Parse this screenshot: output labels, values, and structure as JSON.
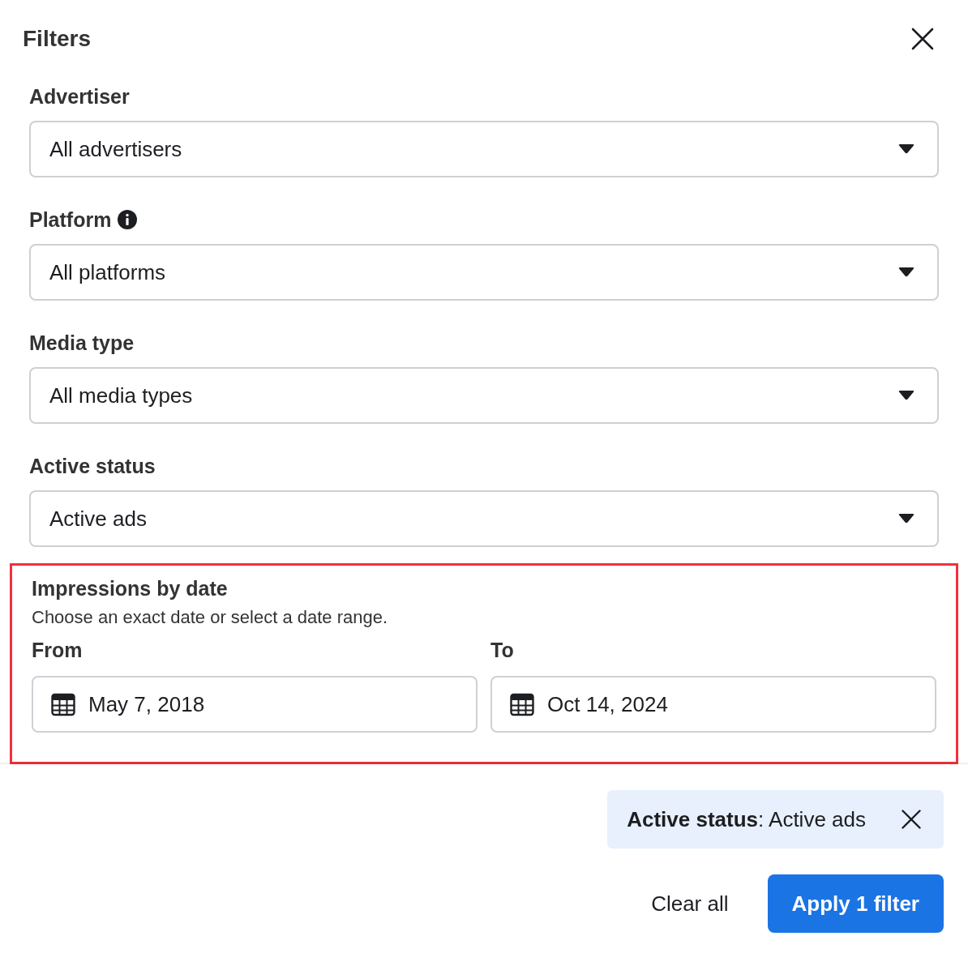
{
  "title": "Filters",
  "fields": [
    {
      "label": "Advertiser",
      "value": "All advertisers"
    },
    {
      "label": "Platform",
      "info": true,
      "value": "All platforms"
    },
    {
      "label": "Media type",
      "value": "All media types"
    },
    {
      "label": "Active status",
      "value": "Active ads"
    }
  ],
  "date_filter": {
    "highlighted": true,
    "title": "Impressions by date",
    "hint": "Choose an exact date or select a date range.",
    "ranges": [
      {
        "label": "From",
        "value": "May 7, 2018"
      },
      {
        "label": "To",
        "value": "Oct 14, 2024"
      }
    ]
  },
  "active_filters": [
    {
      "text": "**Active status**: Active ads"
    }
  ],
  "buttons": {
    "clear": "Clear all",
    "apply": "Apply 1 filter"
  }
}
